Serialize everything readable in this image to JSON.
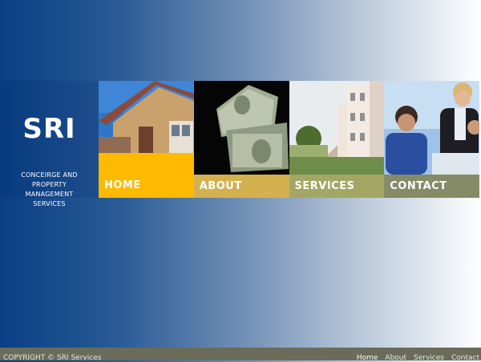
{
  "brand": {
    "title": "SRI",
    "tagline_lines": [
      "CONCEIRGE AND",
      "PROPERTY",
      "MANAGEMENT",
      "SERVICES"
    ]
  },
  "nav": {
    "items": [
      {
        "label": "HOME",
        "photo": "house-icon",
        "color": "#fdba00"
      },
      {
        "label": "ABOUT",
        "photo": "money-house-icon",
        "color": "#d4b04f"
      },
      {
        "label": "SERVICES",
        "photo": "apartments-icon",
        "color": "#a3a763"
      },
      {
        "label": "CONTACT",
        "photo": "business-people-icon",
        "color": "#858b66"
      }
    ]
  },
  "footer": {
    "copyright": "COPYRIGHT © SRI Services",
    "links": [
      "Home",
      "About",
      "Services",
      "Contact"
    ],
    "active": "Home"
  },
  "colors": {
    "footer_bg": "#6b6b5a",
    "brand_bg": "#083a80"
  }
}
